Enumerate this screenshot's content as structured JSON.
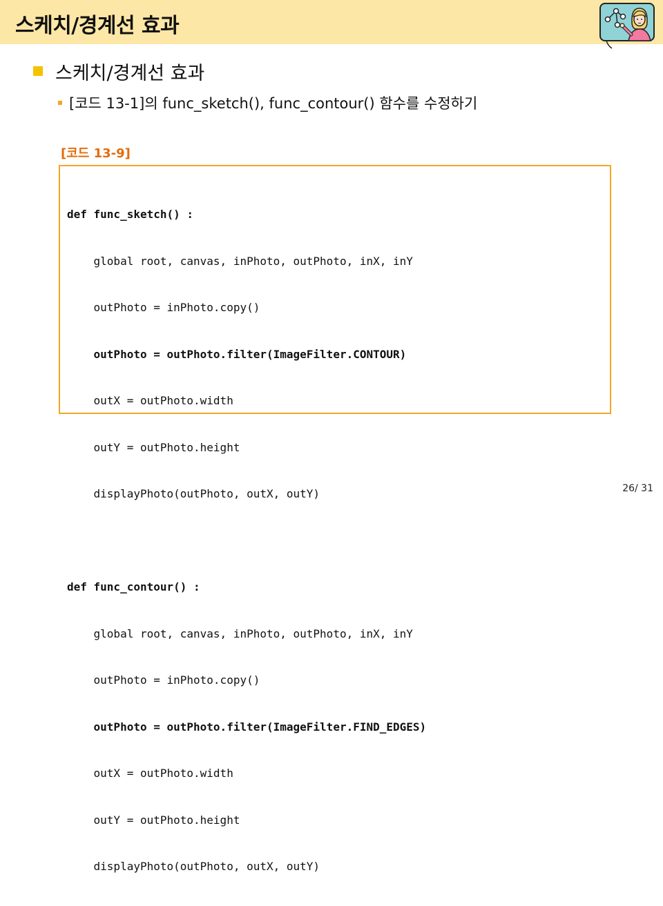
{
  "header": {
    "title": "스케치/경계선 효과"
  },
  "content": {
    "heading": "스케치/경계선 효과",
    "subheading": "[코드 13-1]의 func_sketch(), func_contour() 함수를 수정하기"
  },
  "code": {
    "caption": "[코드 13-9]",
    "lines": [
      {
        "text": "def func_sketch() :",
        "bold": true
      },
      {
        "text": "    global root, canvas, inPhoto, outPhoto, inX, inY",
        "bold": false
      },
      {
        "text": "    outPhoto = inPhoto.copy()",
        "bold": false
      },
      {
        "text": "    outPhoto = outPhoto.filter(ImageFilter.CONTOUR)",
        "bold": true
      },
      {
        "text": "    outX = outPhoto.width",
        "bold": false
      },
      {
        "text": "    outY = outPhoto.height",
        "bold": false
      },
      {
        "text": "    displayPhoto(outPhoto, outX, outY)",
        "bold": false
      },
      {
        "text": "",
        "bold": false
      },
      {
        "text": "def func_contour() :",
        "bold": true
      },
      {
        "text": "    global root, canvas, inPhoto, outPhoto, inX, inY",
        "bold": false
      },
      {
        "text": "    outPhoto = inPhoto.copy()",
        "bold": false
      },
      {
        "text": "    outPhoto = outPhoto.filter(ImageFilter.FIND_EDGES)",
        "bold": true
      },
      {
        "text": "    outX = outPhoto.width",
        "bold": false
      },
      {
        "text": "    outY = outPhoto.height",
        "bold": false
      },
      {
        "text": "    displayPhoto(outPhoto, outX, outY)",
        "bold": false
      }
    ]
  },
  "footer": {
    "page_number": "26/ 31"
  },
  "icons": {
    "mascot": "presenter-illustration-icon"
  },
  "colors": {
    "header_band": "#fde7a6",
    "bullet_primary": "#f5c200",
    "bullet_secondary": "#f5a623",
    "code_caption": "#e36c09",
    "code_border": "#f5a623"
  }
}
